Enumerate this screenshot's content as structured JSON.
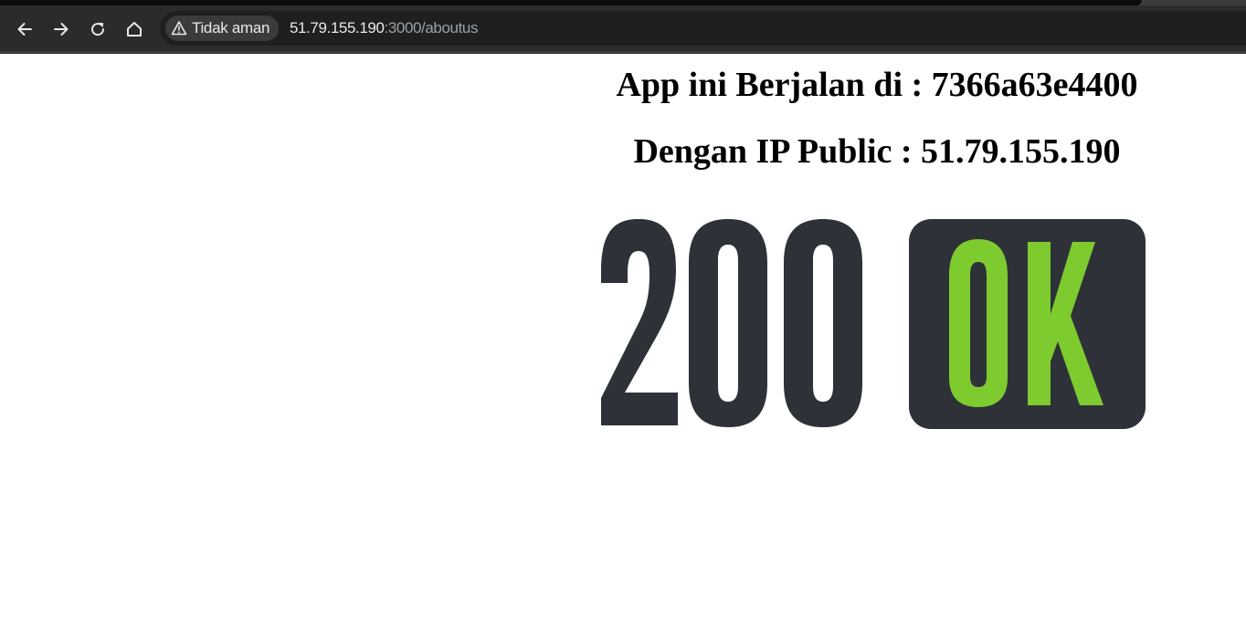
{
  "browser": {
    "security_label": "Tidak aman",
    "url_host": "51.79.155.190",
    "url_rest": ":3000/aboutus",
    "icons": {
      "back": "arrow-left-icon",
      "forward": "arrow-right-icon",
      "reload": "reload-icon",
      "home": "home-icon",
      "warning": "warning-triangle-icon"
    }
  },
  "page": {
    "app_heading": "App ini Berjalan di : 7366a63e4400",
    "ip_heading": "Dengan IP Public : 51.79.155.190",
    "logo": {
      "number_text": "200",
      "badge_text": "OK",
      "colors": {
        "dark": "#2e3238",
        "green": "#7ecb2f"
      }
    }
  },
  "colors": {
    "toolbar_bg": "#2b2b2b",
    "omnibox_bg": "#1f1f1f",
    "chip_bg": "#3b3b3b",
    "page_bg": "#ffffff"
  }
}
